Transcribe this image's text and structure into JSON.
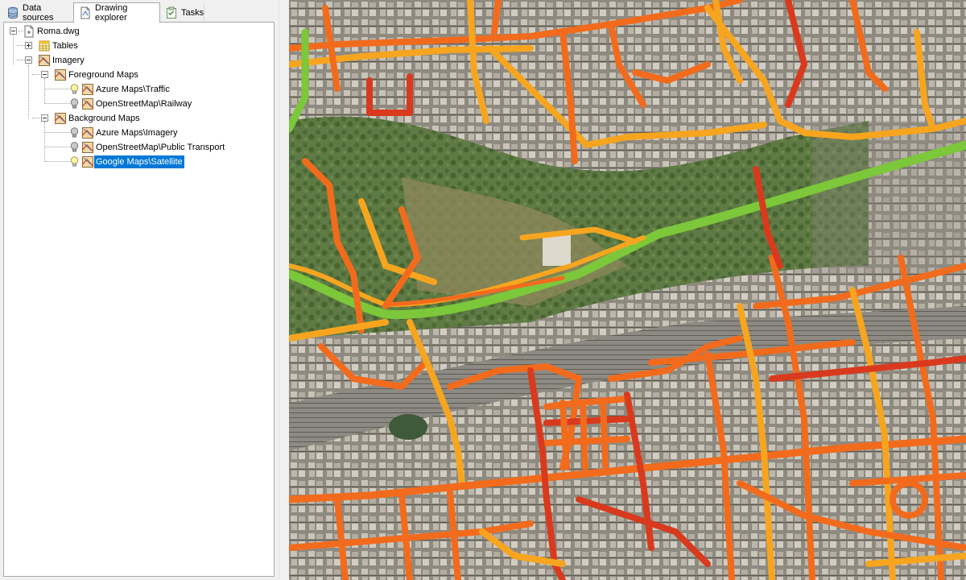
{
  "tabs": [
    {
      "label": "Data sources",
      "icon": "database-icon",
      "active": false
    },
    {
      "label": "Drawing explorer",
      "icon": "drawing-icon",
      "active": true
    },
    {
      "label": "Tasks",
      "icon": "tasks-icon",
      "active": false
    }
  ],
  "tree": {
    "root": {
      "label": "Roma.dwg",
      "icon": "drawing-file-icon"
    },
    "tables": {
      "label": "Tables",
      "icon": "table-icon"
    },
    "imagery": {
      "label": "Imagery",
      "icon": "map-layer-icon"
    },
    "foreground": {
      "label": "Foreground Maps",
      "items": [
        {
          "label": "Azure Maps\\Traffic",
          "visible": true
        },
        {
          "label": "OpenStreetMap\\Railway",
          "visible": false
        }
      ]
    },
    "background": {
      "label": "Background Maps",
      "items": [
        {
          "label": "Azure Maps\\Imagery",
          "visible": false
        },
        {
          "label": "OpenStreetMap\\Public Transport",
          "visible": false
        },
        {
          "label": "Google Maps\\Satellite",
          "visible": true,
          "selected": true
        }
      ]
    }
  },
  "map": {
    "content": "satellite imagery with traffic overlay",
    "traffic_colors": {
      "free_flow": "#7cc73a",
      "moderate": "#f7a51f",
      "slow": "#f26b1d",
      "congested": "#d93a1e"
    }
  }
}
